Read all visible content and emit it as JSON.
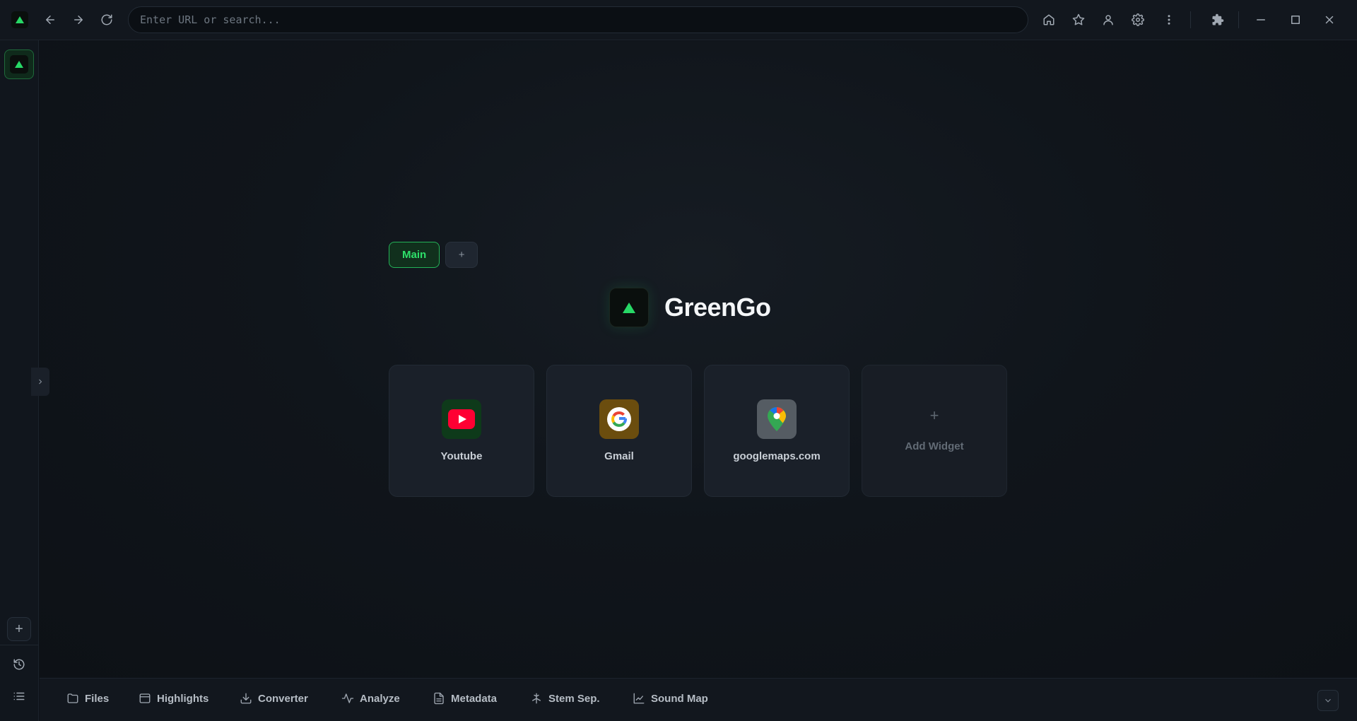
{
  "urlbar": {
    "placeholder": "Enter URL or search..."
  },
  "tabs": {
    "main_label": "Main",
    "add_label": "+"
  },
  "brand": {
    "name": "GreenGo"
  },
  "widgets": [
    {
      "label": "Youtube",
      "icon": "youtube-icon",
      "bg": "#0e3a1a"
    },
    {
      "label": "Gmail",
      "icon": "google-icon",
      "bg": "#6b4d0e"
    },
    {
      "label": "googlemaps.com",
      "icon": "maps-pin-icon",
      "bg": "#555c63"
    }
  ],
  "add_widget": {
    "plus": "+",
    "label": "Add Widget"
  },
  "sidebar": {
    "add_label": "+"
  },
  "bottom_tools": [
    {
      "label": "Files",
      "icon": "folder-icon"
    },
    {
      "label": "Highlights",
      "icon": "window-icon"
    },
    {
      "label": "Converter",
      "icon": "download-icon"
    },
    {
      "label": "Analyze",
      "icon": "pulse-icon"
    },
    {
      "label": "Metadata",
      "icon": "document-icon"
    },
    {
      "label": "Stem Sep.",
      "icon": "split-icon"
    },
    {
      "label": "Sound Map",
      "icon": "chart-icon"
    }
  ],
  "colors": {
    "accent": "#27d866",
    "background": "#0e1218",
    "panel": "#1a2029"
  }
}
